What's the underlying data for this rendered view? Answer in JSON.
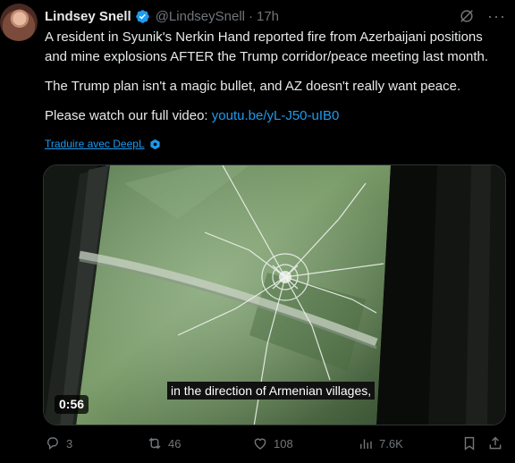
{
  "author": {
    "name": "Lindsey Snell",
    "handle": "@LindseySnell",
    "separator": "·",
    "time": "17h"
  },
  "post": {
    "line1": "A resident in Syunik's Nerkin Hand reported fire from Azerbaijani positions and mine explosions AFTER the Trump corridor/peace meeting last month.",
    "line2": "The Trump plan isn't a magic bullet, and AZ doesn't really want peace.",
    "line3_prefix": "Please watch our full video: ",
    "link": "youtu.be/yL-J50-uIB0"
  },
  "translate_label": "Traduire avec DeepL",
  "video": {
    "duration": "0:56",
    "caption": "in the direction of Armenian villages,"
  },
  "actions": {
    "replies": "3",
    "reposts": "46",
    "likes": "108",
    "views": "7.6K"
  },
  "icons": {
    "verified": "verified-badge-icon",
    "grok": "grok-icon",
    "more": "more-icon",
    "reply": "reply-icon",
    "repost": "repost-icon",
    "like": "heart-icon",
    "views": "views-icon",
    "bookmark": "bookmark-icon",
    "share": "share-icon"
  },
  "colors": {
    "accent": "#1d9bf0",
    "text": "#e7e9ea",
    "muted": "#71767b",
    "background": "#000000"
  }
}
